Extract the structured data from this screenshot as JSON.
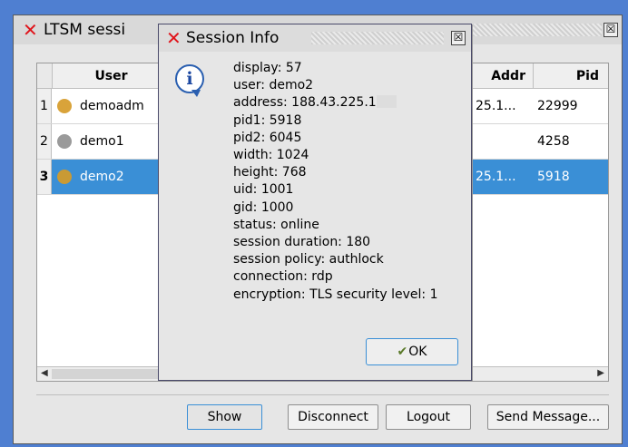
{
  "main_window": {
    "title": "LTSM sessi",
    "close_symbol": "☒",
    "columns": {
      "user": "User",
      "addr": "Addr",
      "pid": "Pid"
    },
    "rows": [
      {
        "num": "1",
        "user": "demoadm",
        "addr": "25.1...",
        "pid": "22999",
        "icon_color": "#d9a33a",
        "selected": false
      },
      {
        "num": "2",
        "user": "demo1",
        "addr": "",
        "pid": "4258",
        "icon_color": "#9a9a9a",
        "selected": false
      },
      {
        "num": "3",
        "user": "demo2",
        "addr": "25.1...",
        "pid": "5918",
        "icon_color": "#c99a34",
        "selected": true
      }
    ],
    "buttons": {
      "show": "Show",
      "disconnect": "Disconnect",
      "logout": "Logout",
      "send_message": "Send Message..."
    }
  },
  "dialog": {
    "title": "Session Info",
    "close_symbol": "☒",
    "icon_glyph": "i",
    "lines": {
      "display": "display: 57",
      "user": "user: demo2",
      "address": "address: 188.43.225.1",
      "pid1": "pid1: 5918",
      "pid2": "pid2: 6045",
      "width": "width: 1024",
      "height": "height: 768",
      "uid": "uid: 1001",
      "gid": "gid: 1000",
      "status": "status: online",
      "duration": "session duration: 180",
      "policy": "session policy: authlock",
      "connection": "connection: rdp",
      "encryption": "encryption: TLS security level: 1"
    },
    "ok_label": "OK"
  },
  "icons": {
    "app_logo": "x-logo-icon",
    "info": "information-icon",
    "ok": "checkmark-icon",
    "user_row": "monkey-icon"
  },
  "colors": {
    "desktop": "#4f7fd1",
    "selection": "#3a8fd6",
    "logo_red": "#e0141b"
  }
}
